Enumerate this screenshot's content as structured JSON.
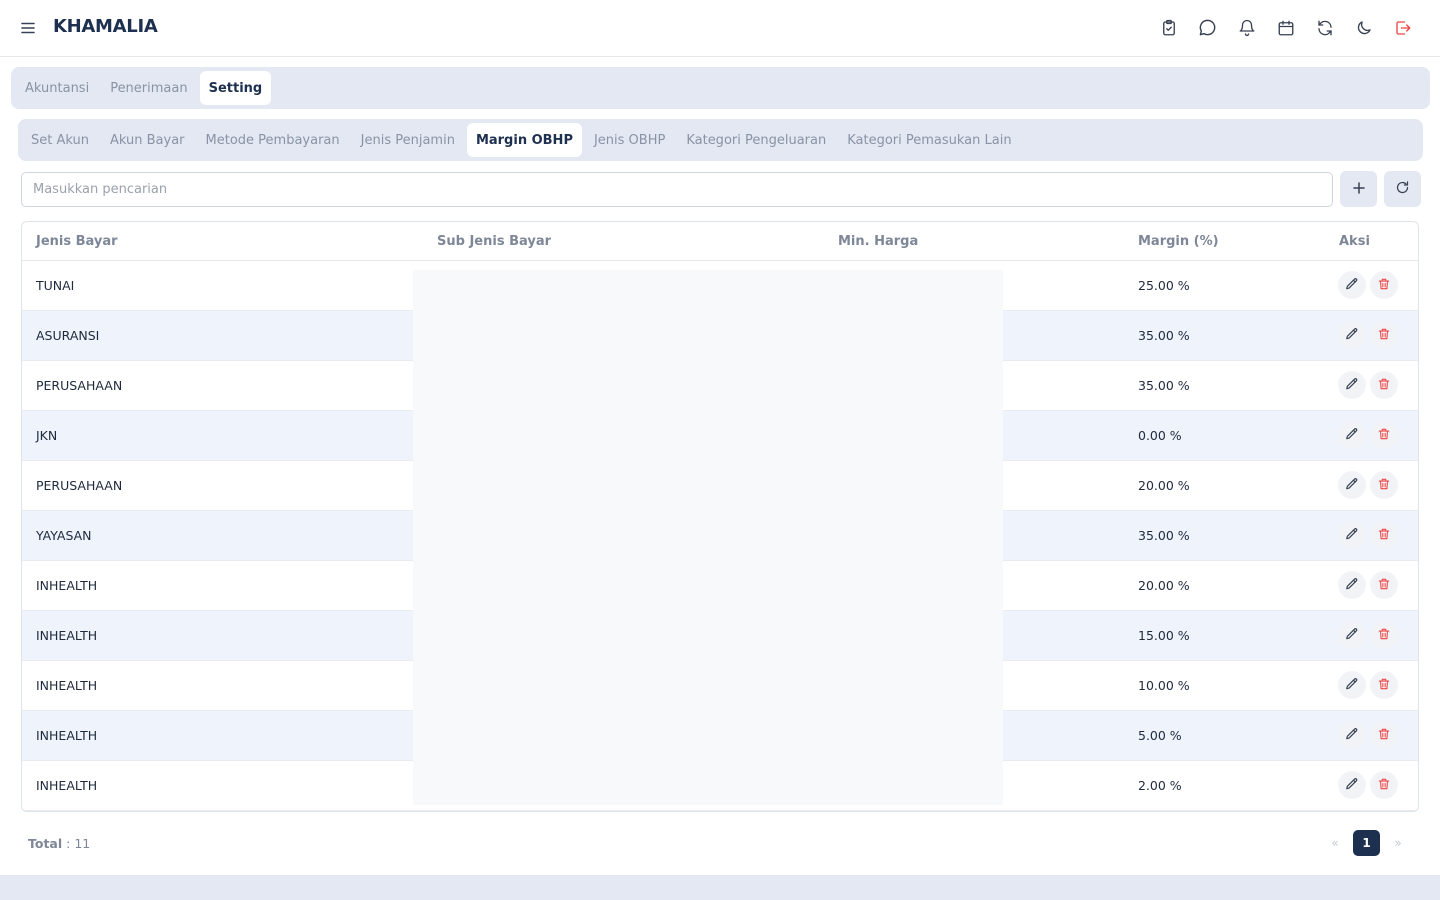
{
  "app": {
    "title": "KHAMALIA"
  },
  "header_icons": [
    "clipboard-check-icon",
    "chat-icon",
    "bell-icon",
    "calendar-icon",
    "refresh-icon",
    "moon-icon",
    "logout-icon"
  ],
  "main_tabs": [
    {
      "label": "Akuntansi",
      "active": false
    },
    {
      "label": "Penerimaan",
      "active": false
    },
    {
      "label": "Setting",
      "active": true
    }
  ],
  "sub_tabs": [
    {
      "label": "Set Akun",
      "active": false
    },
    {
      "label": "Akun Bayar",
      "active": false
    },
    {
      "label": "Metode Pembayaran",
      "active": false
    },
    {
      "label": "Jenis Penjamin",
      "active": false
    },
    {
      "label": "Margin OBHP",
      "active": true
    },
    {
      "label": "Jenis OBHP",
      "active": false
    },
    {
      "label": "Kategori Pengeluaran",
      "active": false
    },
    {
      "label": "Kategori Pemasukan Lain",
      "active": false
    }
  ],
  "search": {
    "placeholder": "Masukkan pencarian",
    "value": ""
  },
  "table": {
    "columns": [
      "Jenis Bayar",
      "Sub Jenis Bayar",
      "Min. Harga",
      "Margin (%)",
      "Aksi"
    ],
    "rows": [
      {
        "jenis_bayar": "TUNAI",
        "margin": "25.00 %"
      },
      {
        "jenis_bayar": "ASURANSI",
        "margin": "35.00 %"
      },
      {
        "jenis_bayar": "PERUSAHAAN",
        "margin": "35.00 %"
      },
      {
        "jenis_bayar": "JKN",
        "margin": "0.00 %"
      },
      {
        "jenis_bayar": "PERUSAHAAN",
        "margin": "20.00 %"
      },
      {
        "jenis_bayar": "YAYASAN",
        "margin": "35.00 %"
      },
      {
        "jenis_bayar": "INHEALTH",
        "margin": "20.00 %"
      },
      {
        "jenis_bayar": "INHEALTH",
        "margin": "15.00 %"
      },
      {
        "jenis_bayar": "INHEALTH",
        "margin": "10.00 %"
      },
      {
        "jenis_bayar": "INHEALTH",
        "margin": "5.00 %"
      },
      {
        "jenis_bayar": "INHEALTH",
        "margin": "2.00 %"
      }
    ]
  },
  "footer": {
    "total_label": "Total",
    "total_value": ": 11"
  },
  "pagination": {
    "prev": "«",
    "current": "1",
    "next": "»"
  },
  "colors": {
    "primary": "#1e3050",
    "tab_bg": "#e3e8f3",
    "row_alt": "#eef3fc",
    "danger": "#ef4444"
  }
}
